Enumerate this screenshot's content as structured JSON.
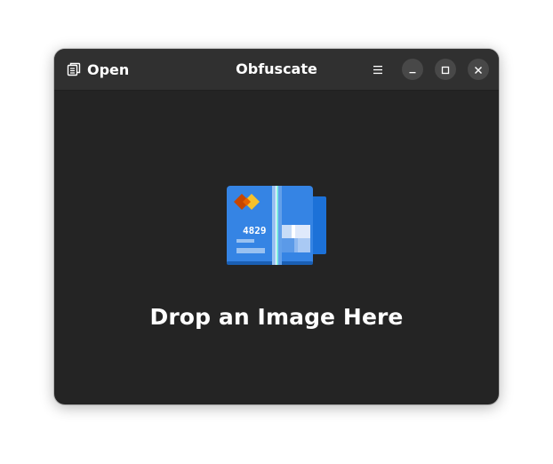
{
  "window": {
    "title": "Obfuscate"
  },
  "headerbar": {
    "open_label": "Open",
    "open_icon": "document-open-icon",
    "menu_icon": "hamburger-menu-icon",
    "controls": {
      "minimize_icon": "minimize-icon",
      "maximize_icon": "maximize-icon",
      "close_icon": "close-icon"
    }
  },
  "main": {
    "drop_label": "Drop an Image Here",
    "illustration": {
      "icon": "credit-card-obfuscate-icon",
      "card_digits": "4829"
    }
  },
  "colors": {
    "window_bg": "#242424",
    "headerbar_bg": "#303030",
    "text": "#ffffff",
    "card_blue": "#3584e4",
    "card_light_blue": "#99c1f1",
    "logo_red": "#e66100",
    "logo_yellow": "#f6d32d"
  }
}
